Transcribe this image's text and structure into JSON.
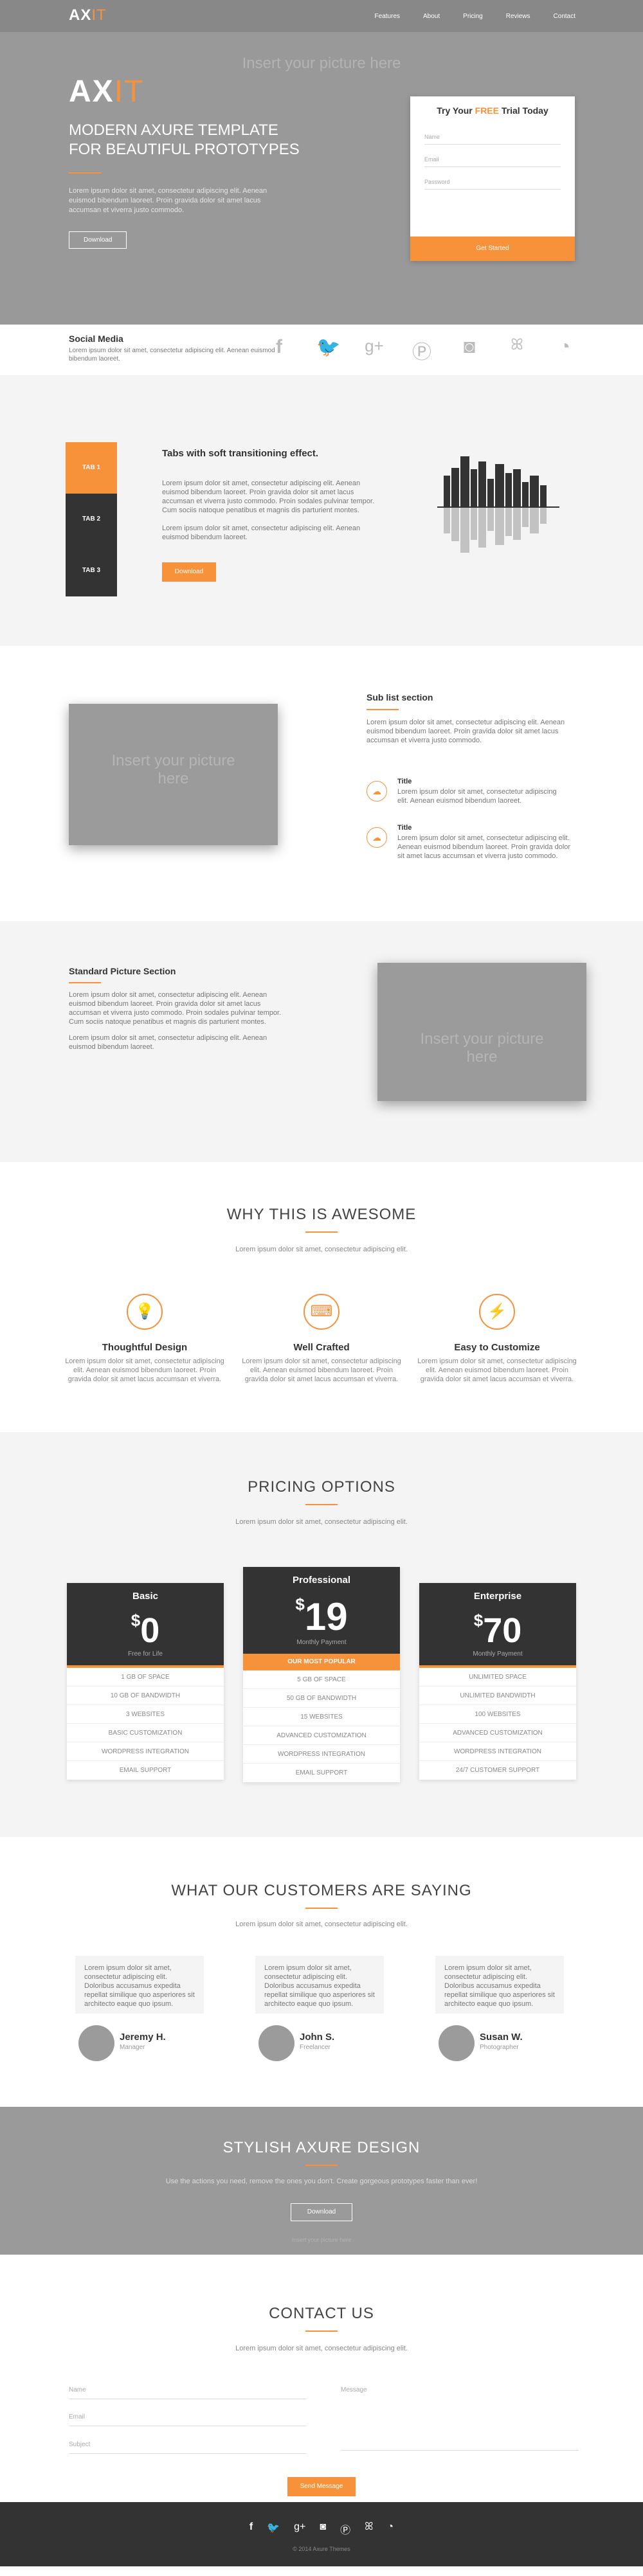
{
  "header": {
    "logo_ax": "AX",
    "logo_it": "IT",
    "menu": [
      "Features",
      "About",
      "Pricing",
      "Reviews",
      "Contact"
    ]
  },
  "hero": {
    "placeholder": "Insert your picture here",
    "logo_ax": "AX",
    "logo_it": "IT",
    "title_line1": "MODERN AXURE TEMPLATE",
    "title_line2": "FOR BEAUTIFUL PROTOTYPES",
    "text": "Lorem ipsum dolor sit amet, consectetur adipiscing elit. Aenean euismod bibendum laoreet. Proin gravida dolor sit amet lacus accumsan et viverra justo commodo.",
    "button": "Download"
  },
  "trial": {
    "title_pre": "Try Your ",
    "title_free": "FREE",
    "title_post": " Trial Today",
    "fields": [
      "Name",
      "Email",
      "Password"
    ],
    "button": "Get Started"
  },
  "social": {
    "title": "Social Media",
    "text": "Lorem ipsum dolor sit amet, consectetur adipiscing elit. Aenean euismod bibendum laoreet.",
    "icons": [
      "f",
      "t",
      "g+",
      "p",
      "ig",
      "su",
      "rss"
    ]
  },
  "tabs": {
    "items": [
      "TAB 1",
      "TAB 2",
      "TAB 3"
    ],
    "title": "Tabs with soft transitioning effect.",
    "p1": "Lorem ipsum dolor sit amet, consectetur adipiscing elit. Aenean euismod bibendum laoreet. Proin gravida dolor sit amet lacus accumsan et viverra justo commodo. Proin sodales pulvinar tempor. Cum sociis natoque penatibus et magnis dis parturient montes.",
    "p2": "Lorem ipsum dolor sit amet, consectetur adipiscing elit. Aenean euismod bibendum laoreet.",
    "button": "Download"
  },
  "sublist": {
    "placeholder": "Insert your picture here",
    "title": "Sub list section",
    "text": "Lorem ipsum dolor sit amet, consectetur adipiscing elit. Aenean euismod bibendum laoreet. Proin gravida dolor sit amet lacus accumsan et viverra justo commodo.",
    "items": [
      {
        "title": "Title",
        "text": "Lorem ipsum dolor sit amet, consectetur adipiscing elit. Aenean euismod bibendum laoreet."
      },
      {
        "title": "Title",
        "text": "Lorem ipsum dolor sit amet, consectetur adipiscing elit. Aenean euismod bibendum laoreet. Proin gravida dolor sit amet lacus accumsan et viverra justo commodo."
      }
    ]
  },
  "standard": {
    "title": "Standard Picture Section",
    "p1": "Lorem ipsum dolor sit amet, consectetur adipiscing elit. Aenean euismod bibendum laoreet. Proin gravida dolor sit amet lacus accumsan et viverra justo commodo. Proin sodales pulvinar tempor. Cum sociis natoque penatibus et magnis dis parturient montes.",
    "p2": "Lorem ipsum dolor sit amet, consectetur adipiscing elit. Aenean euismod bibendum laoreet.",
    "placeholder": "Insert your picture here"
  },
  "awesome": {
    "title": "WHY THIS IS AWESOME",
    "subtitle": "Lorem ipsum dolor sit amet, consectetur adipiscing elit.",
    "features": [
      {
        "title": "Thoughtful Design",
        "text": "Lorem ipsum dolor sit amet, consectetur adipiscing elit. Aenean euismod bibendum laoreet. Proin gravida dolor sit amet lacus accumsan et viverra."
      },
      {
        "title": "Well Crafted",
        "text": "Lorem ipsum dolor sit amet, consectetur adipiscing elit. Aenean euismod bibendum laoreet. Proin gravida dolor sit amet lacus accumsan et viverra."
      },
      {
        "title": "Easy to Customize",
        "text": "Lorem ipsum dolor sit amet, consectetur adipiscing elit. Aenean euismod bibendum laoreet. Proin gravida dolor sit amet lacus accumsan et viverra."
      }
    ]
  },
  "pricing": {
    "title": "PRICING OPTIONS",
    "subtitle": "Lorem ipsum dolor sit amet, consectetur adipiscing elit.",
    "plans": [
      {
        "name": "Basic",
        "currency": "$",
        "price": "0",
        "per": "Free for Life",
        "rows": [
          "1 GB OF SPACE",
          "10 GB OF BANDWIDTH",
          "3 WEBSITES",
          "BASIC CUSTOMIZATION",
          "WORDPRESS INTEGRATION",
          "EMAIL SUPPORT"
        ]
      },
      {
        "name": "Professional",
        "currency": "$",
        "price": "19",
        "per": "Monthly Payment",
        "badge": "OUR MOST POPULAR",
        "rows": [
          "5 GB OF SPACE",
          "50 GB OF BANDWIDTH",
          "15 WEBSITES",
          "ADVANCED CUSTOMIZATION",
          "WORDPRESS INTEGRATION",
          "EMAIL SUPPORT"
        ]
      },
      {
        "name": "Enterprise",
        "currency": "$",
        "price": "70",
        "per": "Monthly Payment",
        "rows": [
          "UNLIMITED SPACE",
          "UNLIMITED BANDWIDTH",
          "100 WEBSITES",
          "ADVANCED CUSTOMIZATION",
          "WORDPRESS INTEGRATION",
          "24/7 CUSTOMER SUPPORT"
        ]
      }
    ]
  },
  "testimonials": {
    "title": "WHAT OUR CUSTOMERS ARE SAYING",
    "subtitle": "Lorem ipsum dolor sit amet, consectetur adipiscing elit.",
    "items": [
      {
        "quote": "Lorem ipsum dolor sit amet, consectetur adipiscing elit. Doloribus accusamus expedita repellat similique quo asperiores sit architecto eaque quo ipsum.",
        "name": "Jeremy H.",
        "role": "Manager"
      },
      {
        "quote": "Lorem ipsum dolor sit amet, consectetur adipiscing elit. Doloribus accusamus expedita repellat similique quo asperiores sit architecto eaque quo ipsum.",
        "name": "John S.",
        "role": "Freelancer"
      },
      {
        "quote": "Lorem ipsum dolor sit amet, consectetur adipiscing elit. Doloribus accusamus expedita repellat similique quo asperiores sit architecto eaque quo ipsum.",
        "name": "Susan W.",
        "role": "Photographer"
      }
    ]
  },
  "stylish": {
    "title": "STYLISH AXURE DESIGN",
    "text": "Use the actions you need, remove the ones you don't. Create gorgeous prototypes faster than ever!",
    "button": "Download",
    "placeholder": "Insert your picture here"
  },
  "contact": {
    "title": "CONTACT US",
    "subtitle": "Lorem ipsum dolor sit amet, consectetur adipiscing elit.",
    "fields": {
      "name": "Name",
      "email": "Email",
      "subject": "Subject",
      "message": "Message"
    },
    "button": "Send Message"
  },
  "footer": {
    "icons": [
      "f",
      "t",
      "g+",
      "ig",
      "p",
      "su",
      "rss"
    ],
    "copyright": "© 2014 Axure Themes"
  },
  "colors": {
    "accent": "#f7923a",
    "dark": "#333333",
    "placeholder_gray": "#9b9b9b"
  }
}
